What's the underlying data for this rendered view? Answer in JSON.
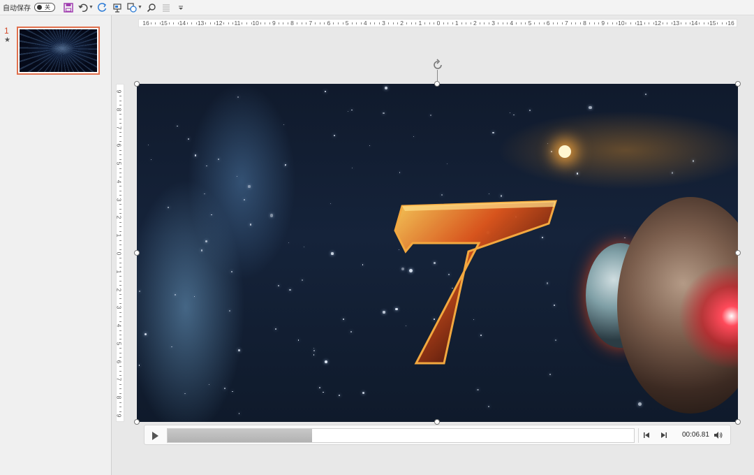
{
  "toolbar": {
    "autosave_label": "自动保存",
    "autosave_state": "关",
    "icons": [
      "save-icon",
      "undo-icon",
      "redo-icon",
      "present-icon",
      "shapes-icon",
      "search-icon",
      "align-icon",
      "customize-icon"
    ]
  },
  "slides_pane": {
    "slides": [
      {
        "number": "1",
        "marker": "★"
      }
    ]
  },
  "ruler": {
    "horizontal": [
      "16",
      "15",
      "14",
      "13",
      "12",
      "11",
      "10",
      "9",
      "8",
      "7",
      "6",
      "5",
      "4",
      "3",
      "2",
      "1",
      "0",
      "1",
      "2",
      "3",
      "4",
      "5",
      "6",
      "7",
      "8",
      "9",
      "10",
      "11",
      "12",
      "13",
      "14",
      "15",
      "16"
    ],
    "vertical": [
      "9",
      "8",
      "7",
      "6",
      "5",
      "4",
      "3",
      "2",
      "1",
      "0",
      "1",
      "2",
      "3",
      "4",
      "5",
      "6",
      "7",
      "8",
      "9"
    ]
  },
  "media": {
    "time": "00:06.81",
    "progress": 0.31,
    "icons": [
      "play-icon",
      "step-back-icon",
      "step-forward-icon",
      "volume-icon"
    ]
  },
  "video_frame": {
    "digit": "7"
  },
  "colors": {
    "accent": "#d24726",
    "selection_border": "#e06f4c",
    "background": "#e8e8e8"
  }
}
